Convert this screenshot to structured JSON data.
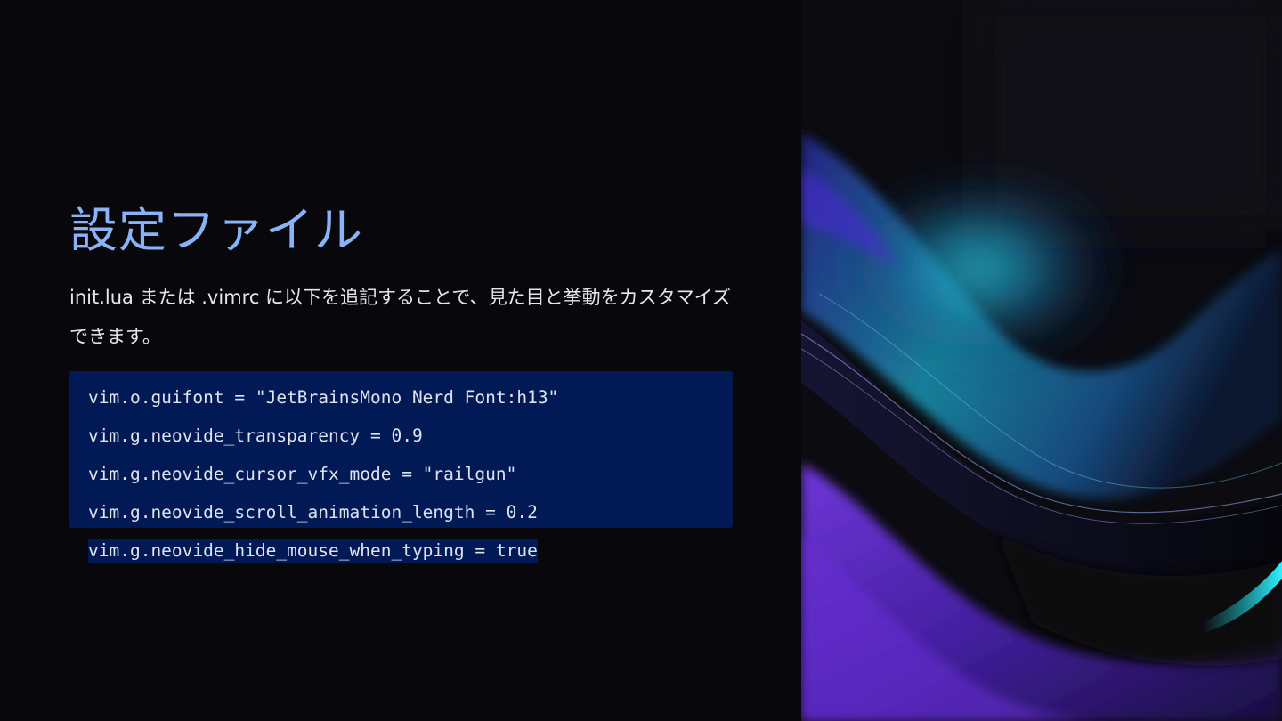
{
  "slide": {
    "title": "設定ファイル",
    "description": "init.lua または .vimrc に以下を追記することで、見た目と挙動をカスタマイズできます。",
    "code_lines": [
      "vim.o.guifont = \"JetBrainsMono Nerd Font:h13\"",
      "vim.g.neovide_transparency = 0.9",
      "vim.g.neovide_cursor_vfx_mode = \"railgun\"",
      "vim.g.neovide_scroll_animation_length = 0.2",
      "vim.g.neovide_hide_mouse_when_typing = true"
    ],
    "colors": {
      "background": "#08080c",
      "title": "#8ab2f6",
      "text": "#e4e6ee",
      "code_background": "#011a55",
      "accent_cyan": "#2bd3e0",
      "accent_purple": "#6a2fd8"
    },
    "image": "abstract-purple-cyan-waves"
  }
}
